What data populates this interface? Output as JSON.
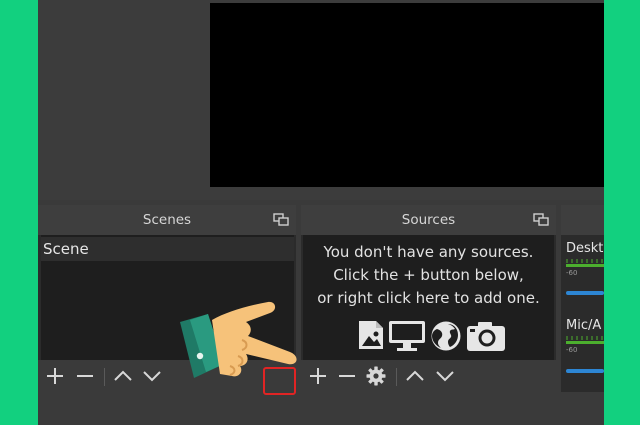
{
  "docks": {
    "scenes": {
      "title": "Scenes",
      "items": [
        "Scene"
      ]
    },
    "sources": {
      "title": "Sources",
      "empty_message": [
        "You don't have any sources.",
        "Click the + button below,",
        "or right click here to add one."
      ]
    },
    "mixer": {
      "channels": [
        {
          "name": "Deskt",
          "scale_label": "-60"
        },
        {
          "name": "Mic/A",
          "scale_label": "-60"
        }
      ]
    }
  },
  "icons": {
    "toolbar": [
      "plus-icon",
      "minus-icon",
      "gear-icon",
      "arrow-up-icon",
      "arrow-down-icon"
    ],
    "source_types": [
      "image-icon",
      "monitor-icon",
      "globe-icon",
      "camera-icon"
    ],
    "dock_header": "float-dock-icon"
  },
  "colors": {
    "background_green": "#12d07f",
    "panel_dark": "#2b2b2b",
    "list_bg": "#1e1e1e",
    "highlight_red": "#e02424",
    "meter_green": "#4caf2e",
    "volume_blue": "#2d86d4"
  }
}
